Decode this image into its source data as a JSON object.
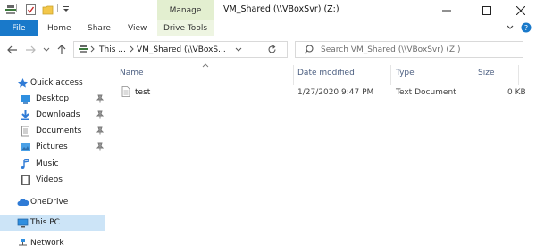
{
  "window": {
    "title": "VM_Shared (\\\\VBoxSvr) (Z:)",
    "contextual_tab": "Manage"
  },
  "ribbon": {
    "tabs": [
      "File",
      "Home",
      "Share",
      "View"
    ],
    "drive_tools": "Drive Tools"
  },
  "address": {
    "crumbs": [
      "This ...",
      "VM_Shared (\\\\VBoxS..."
    ]
  },
  "search": {
    "placeholder": "Search VM_Shared (\\\\VBoxSvr) (Z:)"
  },
  "sidebar": {
    "items": [
      {
        "label": "Quick access",
        "icon": "star-icon"
      },
      {
        "label": "Desktop",
        "icon": "desktop-folder-icon",
        "pinned": true
      },
      {
        "label": "Downloads",
        "icon": "download-folder-icon",
        "pinned": true
      },
      {
        "label": "Documents",
        "icon": "documents-folder-icon",
        "pinned": true
      },
      {
        "label": "Pictures",
        "icon": "pictures-folder-icon",
        "pinned": true
      },
      {
        "label": "Music",
        "icon": "music-icon"
      },
      {
        "label": "Videos",
        "icon": "videos-icon"
      },
      {
        "label": "OneDrive",
        "icon": "cloud-icon"
      },
      {
        "label": "This PC",
        "icon": "computer-icon",
        "selected": true
      },
      {
        "label": "Network",
        "icon": "network-icon"
      }
    ]
  },
  "table": {
    "columns": [
      "Name",
      "Date modified",
      "Type",
      "Size"
    ],
    "rows": [
      {
        "name": "test",
        "date": "1/27/2020 9:47 PM",
        "type": "Text Document",
        "size": "0 KB"
      }
    ]
  },
  "colors": {
    "accent": "#1979ca",
    "selection": "#cce4f7",
    "manage_tab": "#e3efd0"
  }
}
